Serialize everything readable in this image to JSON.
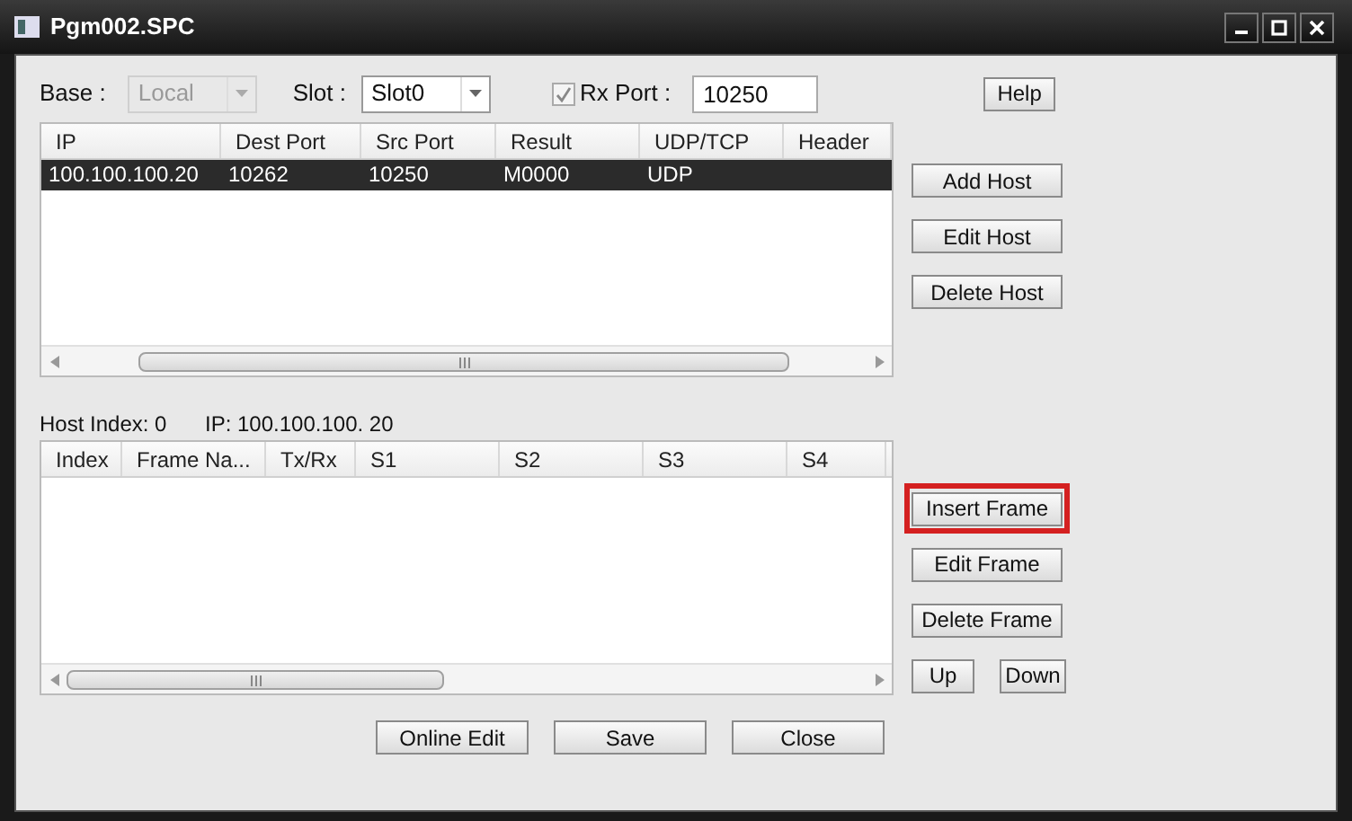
{
  "window": {
    "title": "Pgm002.SPC"
  },
  "base": {
    "label": "Base :",
    "value": "Local",
    "disabled": true
  },
  "slot": {
    "label": "Slot :",
    "value": "Slot0",
    "disabled": false
  },
  "rx_port": {
    "label": "Rx Port :",
    "checked": true,
    "value": "10250"
  },
  "help_button": "Help",
  "host_table": {
    "columns": [
      "IP",
      "Dest Port",
      "Src Port",
      "Result",
      "UDP/TCP",
      "Header"
    ],
    "rows": [
      {
        "cells": [
          "100.100.100.20",
          "10262",
          "10250",
          "M0000",
          "UDP",
          ""
        ],
        "selected": true
      }
    ]
  },
  "host_buttons": [
    {
      "label": "Add Host",
      "highlighted": false
    },
    {
      "label": "Edit Host",
      "highlighted": false
    },
    {
      "label": "Delete Host",
      "highlighted": false
    }
  ],
  "host_info": {
    "index": "Host Index: 0",
    "ip": "IP: 100.100.100. 20"
  },
  "frame_table": {
    "columns": [
      "Index",
      "Frame Na...",
      "Tx/Rx",
      "S1",
      "S2",
      "S3",
      "S4"
    ]
  },
  "frame_buttons": [
    {
      "label": "Insert Frame",
      "highlighted": true
    },
    {
      "label": "Edit Frame",
      "highlighted": false
    },
    {
      "label": "Delete Frame",
      "highlighted": false
    }
  ],
  "move_buttons": [
    "Up",
    "Down"
  ],
  "bottom_buttons": [
    "Online Edit",
    "Save",
    "Close"
  ]
}
